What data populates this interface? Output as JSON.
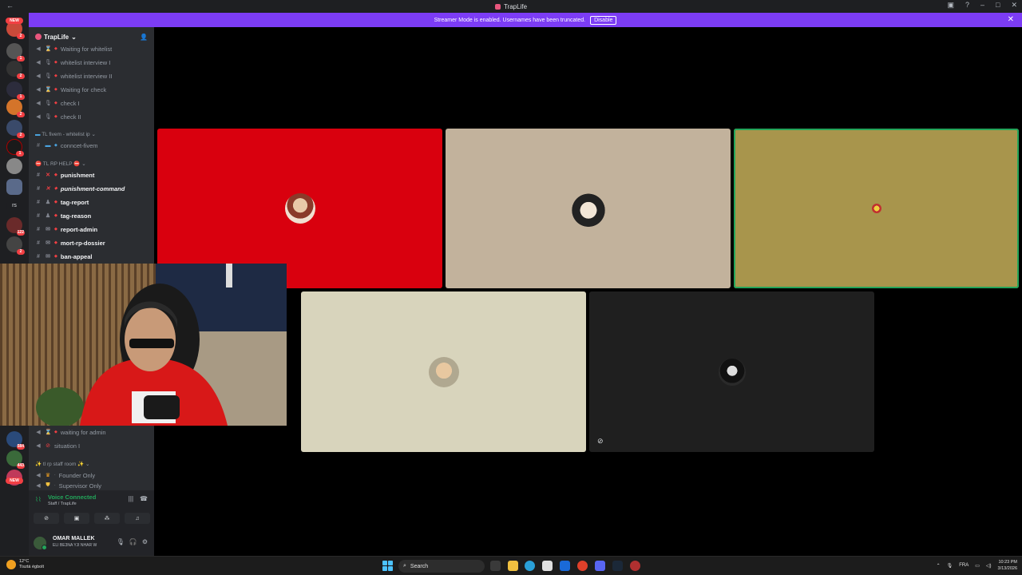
{
  "window": {
    "title": "TrapLife"
  },
  "banner": {
    "message": "Streamer Mode is enabled. Usernames have been truncated.",
    "button": "Disable"
  },
  "server": {
    "name": "TrapLife"
  },
  "rail": {
    "badges": [
      "2",
      "1",
      "2",
      "1",
      "2",
      "2",
      "1",
      "122",
      "2",
      "584",
      "443"
    ],
    "new_label": "NEW",
    "text_server": "rs"
  },
  "channels": {
    "items": [
      {
        "label": "Waiting for whitelist",
        "type": "voice"
      },
      {
        "label": "whitelist interview I",
        "type": "voice"
      },
      {
        "label": "whitelist interview II",
        "type": "voice"
      },
      {
        "label": "Waiting for check",
        "type": "voice"
      },
      {
        "label": "check I",
        "type": "voice"
      },
      {
        "label": "check II",
        "type": "voice"
      }
    ],
    "cat_fivem": "TL fivem - whitelist ip",
    "connect": "conncet-fivem",
    "cat_help": "TL RP HELP",
    "help_items": [
      "punishment",
      "punishment-command",
      "tag-report",
      "tag-reason",
      "report-admin",
      "mort-rp-dossier",
      "ban-appeal"
    ],
    "lower_items": [
      "waiting for admin",
      "situation I"
    ],
    "cat_staff": "tl rp staff room",
    "staff_items": [
      "Founder Only",
      "Supervisor Only"
    ]
  },
  "voice": {
    "status": "Voice Connected",
    "channel": "Staff / TrapLife"
  },
  "user": {
    "name": "OMAR MALLEK",
    "status": "ELI BE3NA YJI NHAR W"
  },
  "taskbar": {
    "weather_temp": "12°C",
    "weather_desc": "Tisztá égbolt",
    "search": "Search",
    "lang": "FRA",
    "time": "10:23 PM",
    "date": "3/13/2026"
  },
  "colors": {
    "banner": "#7c3cf5",
    "speaking": "#23a55a",
    "tile_red": "#d9000e",
    "tile_beige": "#c2b29c",
    "tile_olive": "#a8954c",
    "tile_cream": "#d8d4bc",
    "tile_dark": "#1f1f1f"
  }
}
